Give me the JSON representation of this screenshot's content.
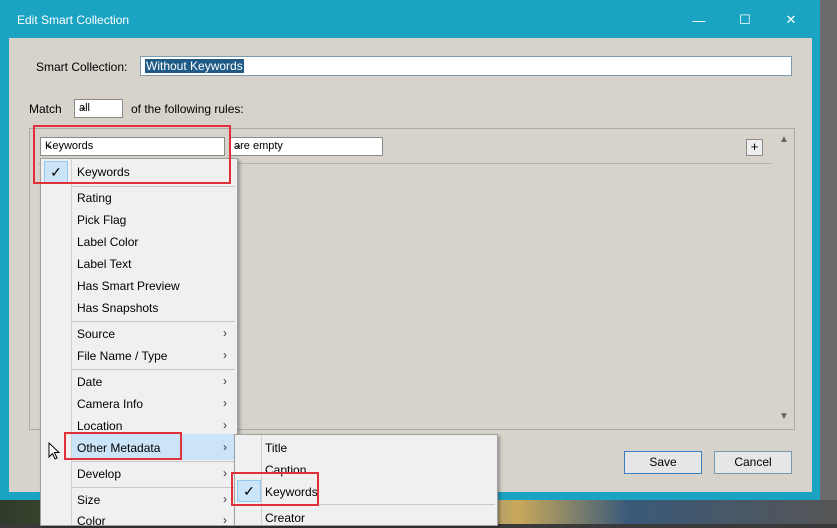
{
  "window": {
    "title": "Edit Smart Collection",
    "controls": {
      "minimize": "—",
      "maximize": "☐",
      "close": "✕"
    }
  },
  "form": {
    "name_label": "Smart Collection:",
    "name_value": "Without Keywords",
    "match_label": "Match",
    "match_value": "all",
    "match_suffix": "of the following rules:"
  },
  "rule": {
    "field": "Keywords",
    "operator": "are empty",
    "add_label": "+"
  },
  "buttons": {
    "save": "Save",
    "cancel": "Cancel"
  },
  "menu": {
    "checked_item": "Keywords",
    "check_glyph": "✓",
    "group1": [
      "Rating",
      "Pick Flag",
      "Label Color",
      "Label Text",
      "Has Smart Preview",
      "Has Snapshots"
    ],
    "group2": [
      "Source",
      "File Name / Type"
    ],
    "group3": [
      "Date",
      "Camera Info",
      "Location",
      "Other Metadata"
    ],
    "group4": [
      "Develop"
    ],
    "group5": [
      "Size",
      "Color"
    ],
    "submenu_arrow": "›"
  },
  "submenu": {
    "items": [
      "Title",
      "Caption",
      "Keywords",
      "Creator"
    ],
    "checked_item": "Keywords"
  }
}
